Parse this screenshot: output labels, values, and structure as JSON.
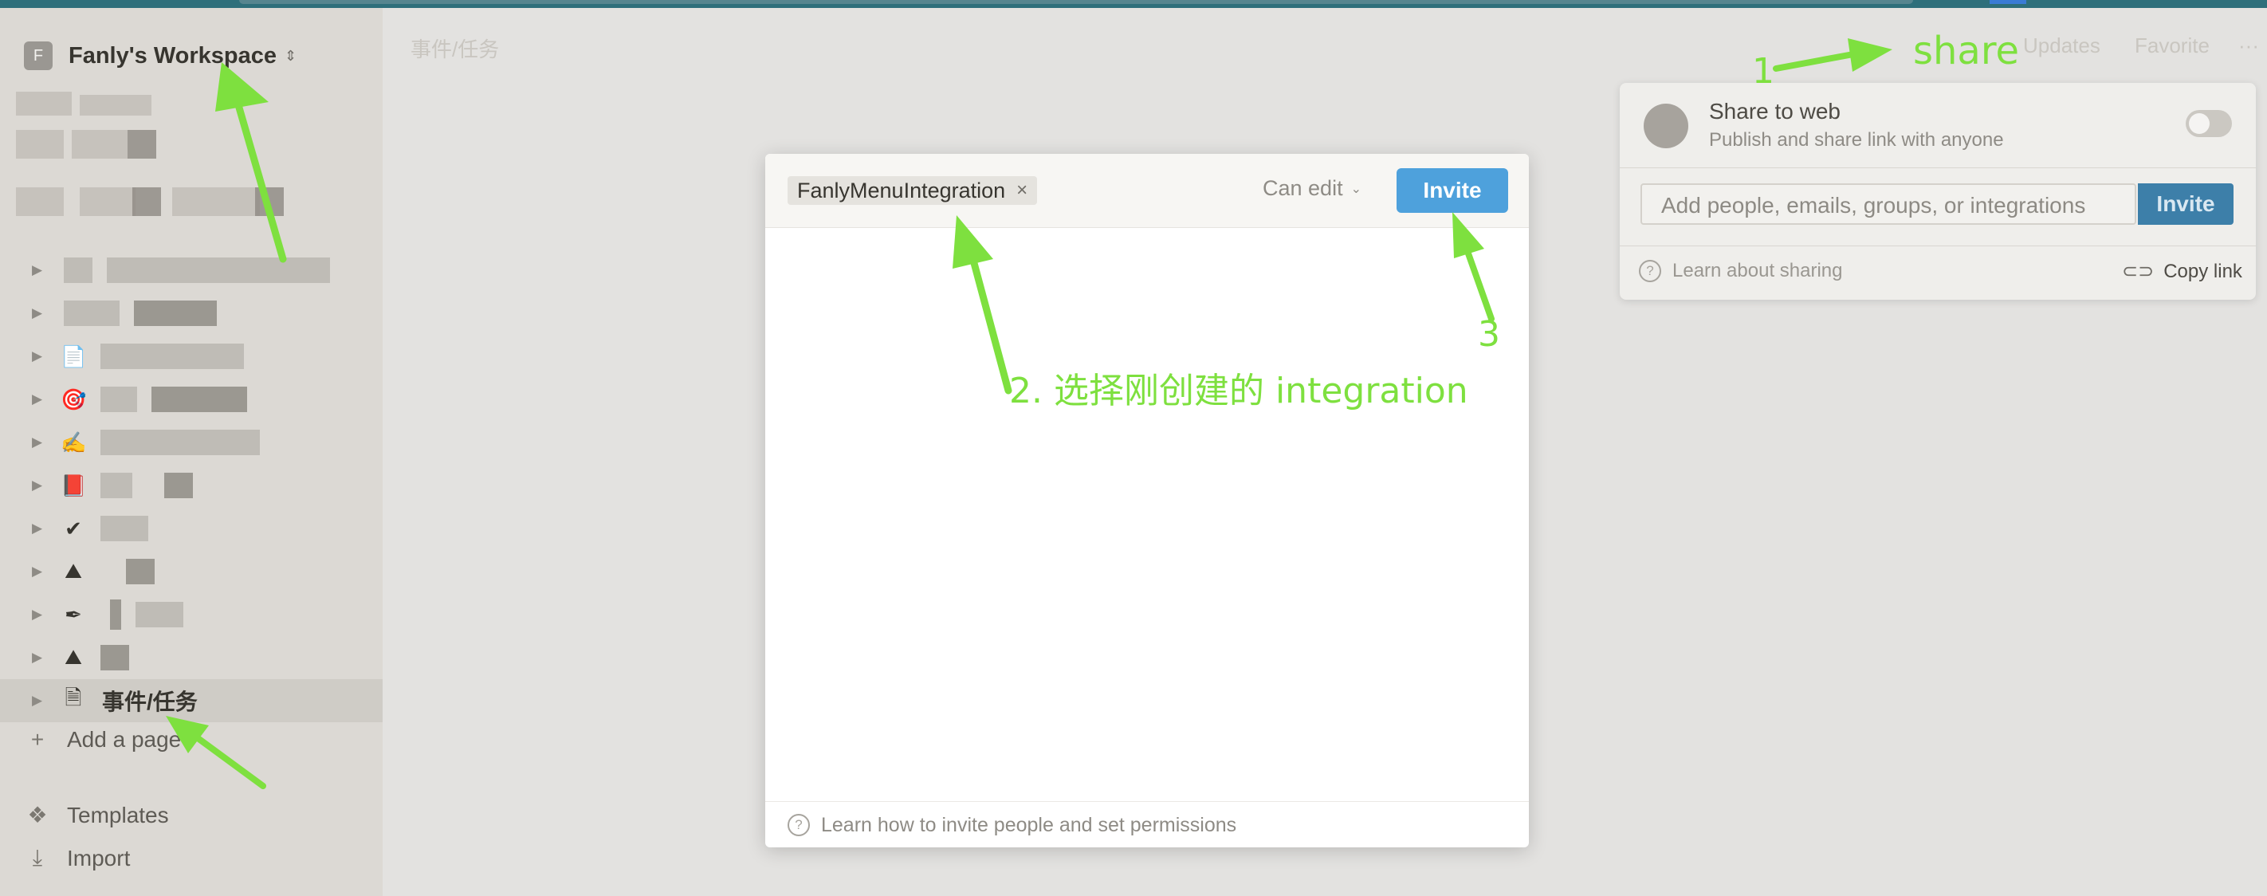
{
  "workspace": {
    "initial": "F",
    "name": "Fanly's Workspace"
  },
  "sidebar": {
    "active_page": "事件/任务",
    "add_page": "Add a page",
    "templates": "Templates",
    "import": "Import",
    "row_emojis": [
      "",
      "",
      "📄",
      "🎯",
      "✍",
      "📕",
      "✔",
      "⛰",
      "✒",
      "⛰"
    ]
  },
  "main": {
    "breadcrumb": "事件/任务",
    "topbar_items": [
      "Updates",
      "Favorite",
      "···"
    ]
  },
  "share_panel": {
    "title": "Share to web",
    "subtitle": "Publish and share link with anyone",
    "toggle_on": false,
    "placeholder": "Add people, emails, groups, or integrations",
    "invite": "Invite",
    "learn": "Learn about sharing",
    "copy_link": "Copy link"
  },
  "modal": {
    "tag": "FanlyMenuIntegration",
    "tag_remove": "×",
    "permission": "Can edit",
    "invite": "Invite",
    "footer": "Learn how to invite people and set permissions"
  },
  "annotations": {
    "step1_num": "1",
    "step1_text": "share",
    "step2": "2. 选择刚创建的 integration",
    "step3": "3",
    "color": "#7ee03f"
  }
}
